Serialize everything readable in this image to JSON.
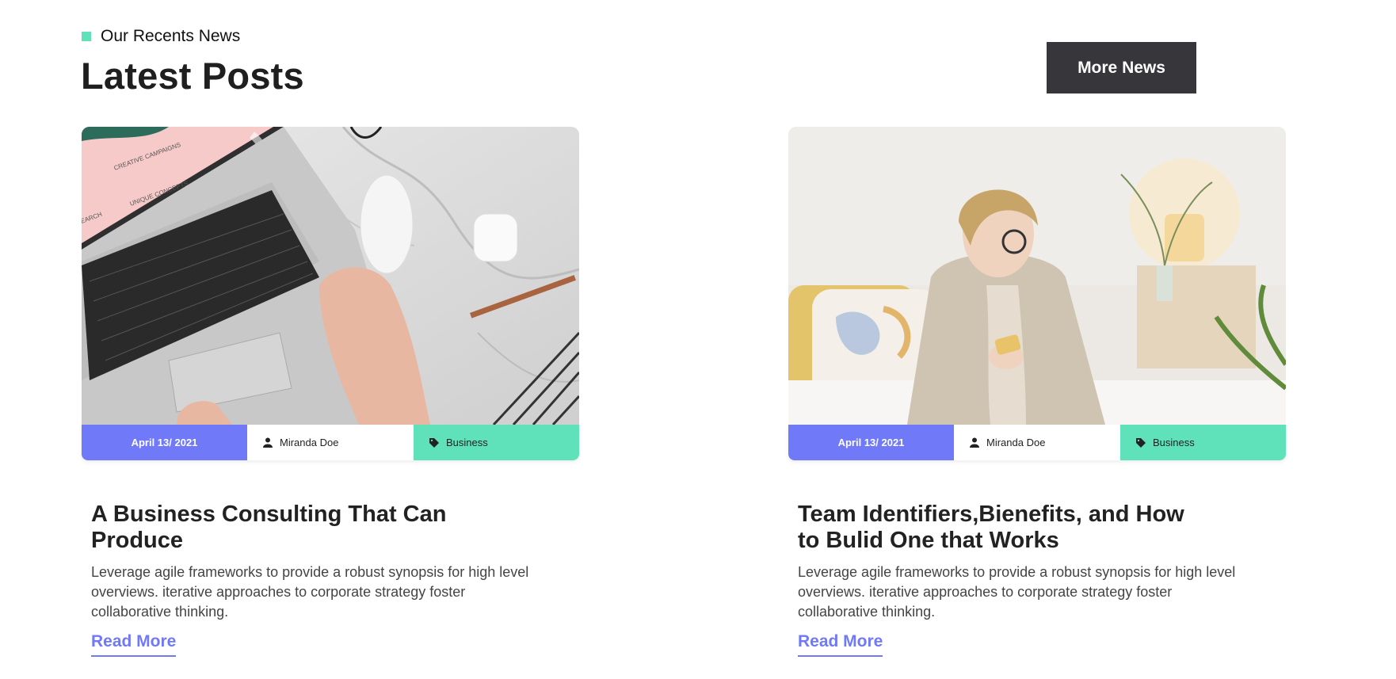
{
  "section": {
    "eyebrow": "Our Recents News",
    "title": "Latest Posts",
    "more_button": "More News"
  },
  "colors": {
    "accent_blue": "#7079f7",
    "accent_green": "#5fe2b9",
    "button_dark": "#36363b"
  },
  "posts": [
    {
      "image_desc": "laptop-on-marble-desk",
      "date": "April 13/ 2021",
      "author": "Miranda Doe",
      "category": "Business",
      "title": "A Business Consulting That Can Produce",
      "excerpt": "Leverage agile frameworks to provide a robust synopsis for high level overviews. iterative approaches to corporate strategy foster collaborative thinking.",
      "read_more": "Read More",
      "screen_text": [
        "CREATIVE CAMPAIGNS",
        "UNIQUE CONCEPTS",
        "EARCH"
      ]
    },
    {
      "image_desc": "woman-with-phone-on-bed",
      "date": "April 13/ 2021",
      "author": "Miranda Doe",
      "category": "Business",
      "title": "Team Identifiers,Bienefits, and How to Bulid One that Works",
      "excerpt": "Leverage agile frameworks to provide a robust synopsis for high level overviews. iterative approaches to corporate strategy foster collaborative thinking.",
      "read_more": "Read More"
    }
  ],
  "icons": {
    "author": "user-icon",
    "category": "tag-icon"
  }
}
